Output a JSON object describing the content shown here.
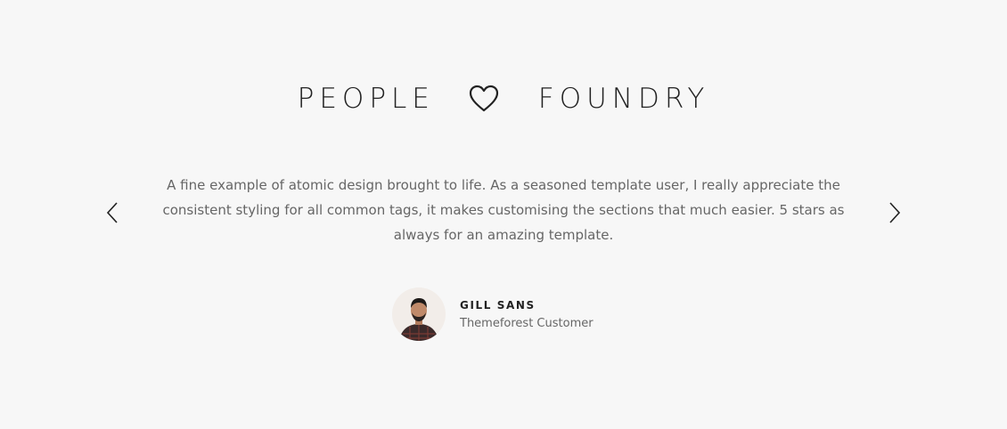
{
  "heading": {
    "left_word": "PEOPLE",
    "right_word": "FOUNDRY",
    "icon": "heart-outline-icon"
  },
  "carousel": {
    "prev_icon": "chevron-left-icon",
    "next_icon": "chevron-right-icon"
  },
  "testimonial": {
    "quote": "A fine example of atomic design brought to life. As a seasoned template user, I really appreciate the consistent styling for all common tags, it makes customising the sections that much easier. 5 stars as always for an amazing template.",
    "author_name": "GILL SANS",
    "author_role": "Themeforest Customer",
    "avatar_icon": "avatar-photo"
  },
  "colors": {
    "background": "#f7f7f7",
    "heading": "#222222",
    "body_text": "#666666"
  }
}
